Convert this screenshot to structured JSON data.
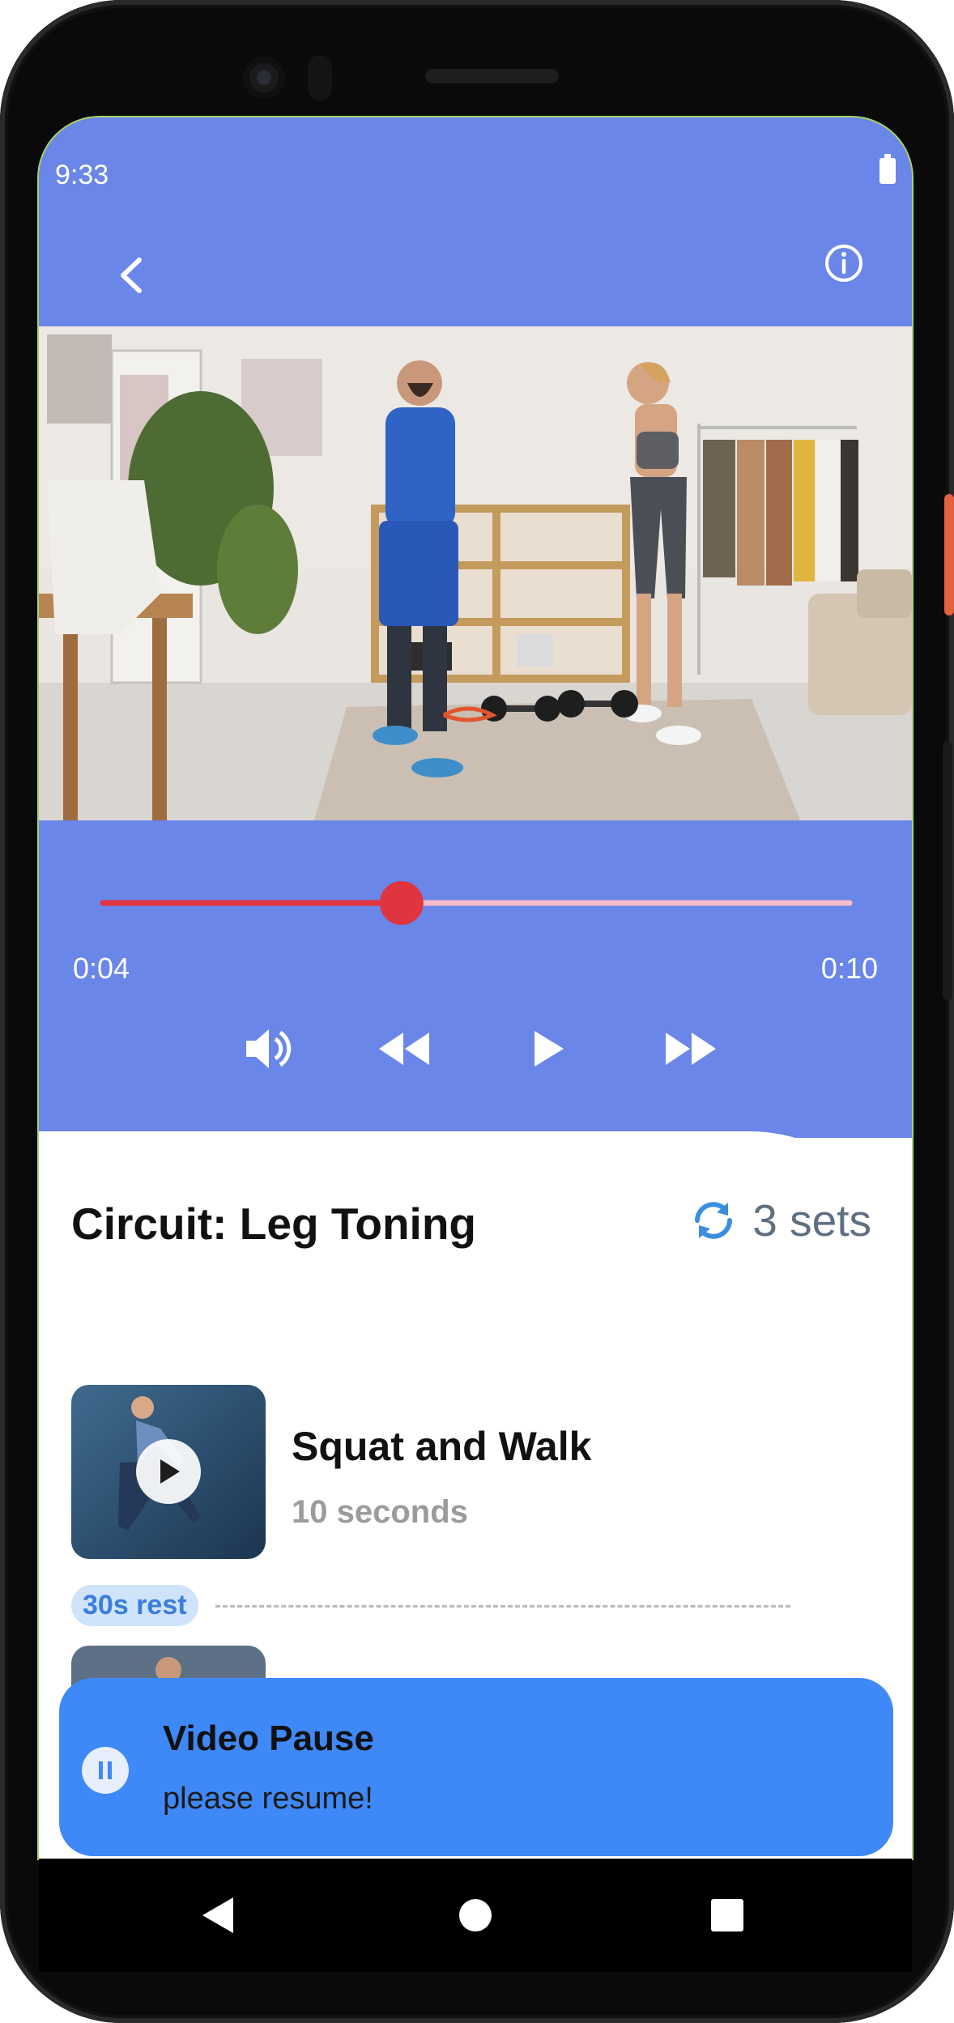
{
  "status_bar": {
    "time": "9:33"
  },
  "header": {
    "back_icon": "chevron-left-icon",
    "info_icon": "info-circle-icon"
  },
  "player": {
    "current_time": "0:04",
    "total_time": "0:10",
    "progress": 0.4,
    "colors": {
      "played": "#e0343e",
      "remaining": "#f7bcc9",
      "thumb": "#e0343e"
    },
    "controls": [
      "volume-icon",
      "rewind-icon",
      "play-icon",
      "fast-forward-icon"
    ]
  },
  "circuit": {
    "title": "Circuit: Leg Toning",
    "sets_label": "3 sets",
    "sets_icon": "refresh-icon",
    "exercises": [
      {
        "name": "Squat and Walk",
        "duration": "10 seconds",
        "rest": "30s rest"
      }
    ]
  },
  "toast": {
    "title": "Video Pause",
    "message": "please resume!",
    "icon": "pause-icon"
  },
  "nav": [
    "back-triangle-icon",
    "home-circle-icon",
    "recents-square-icon"
  ],
  "colors": {
    "header": "#6a86e8",
    "toast": "#3f88f7",
    "accent": "#3a7ede"
  }
}
